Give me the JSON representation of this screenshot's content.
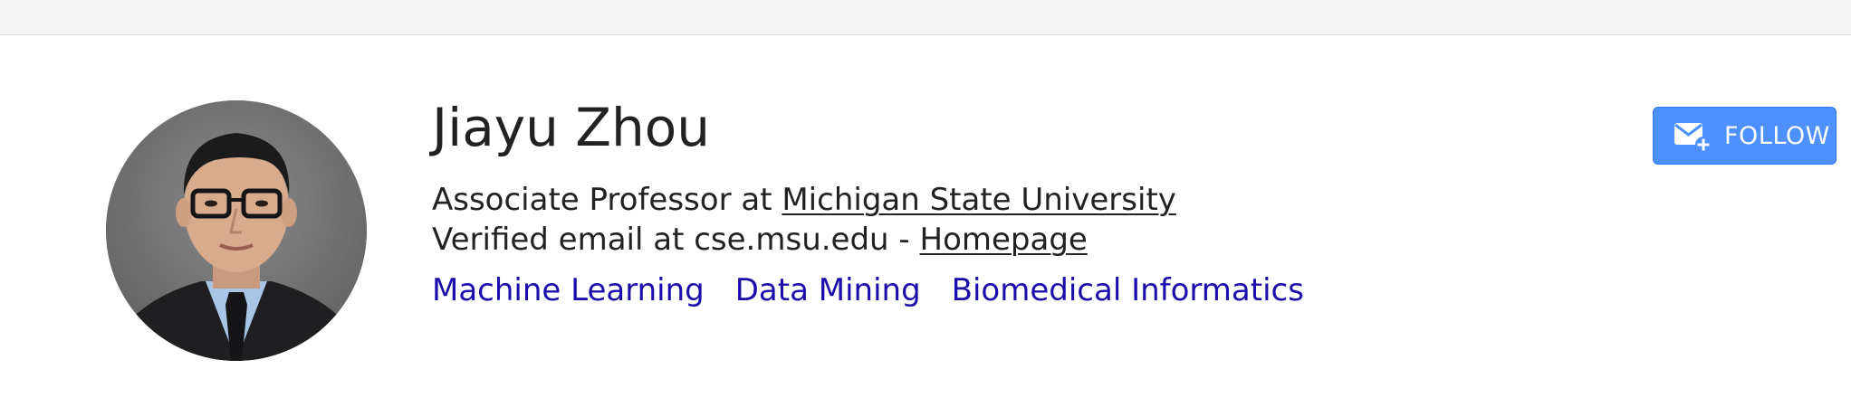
{
  "profile": {
    "name": "Jiayu Zhou",
    "position_prefix": "Associate Professor at ",
    "affiliation": "Michigan State University",
    "email_text": "Verified email at cse.msu.edu - ",
    "homepage_label": "Homepage",
    "interests": [
      "Machine Learning",
      "Data Mining",
      "Biomedical Informatics"
    ]
  },
  "follow": {
    "label": "FOLLOW",
    "icon": "mail-plus-icon"
  },
  "colors": {
    "link": "#1a0dab",
    "button": "#4d90fe",
    "text": "#222222",
    "topbar": "#f5f5f5"
  }
}
